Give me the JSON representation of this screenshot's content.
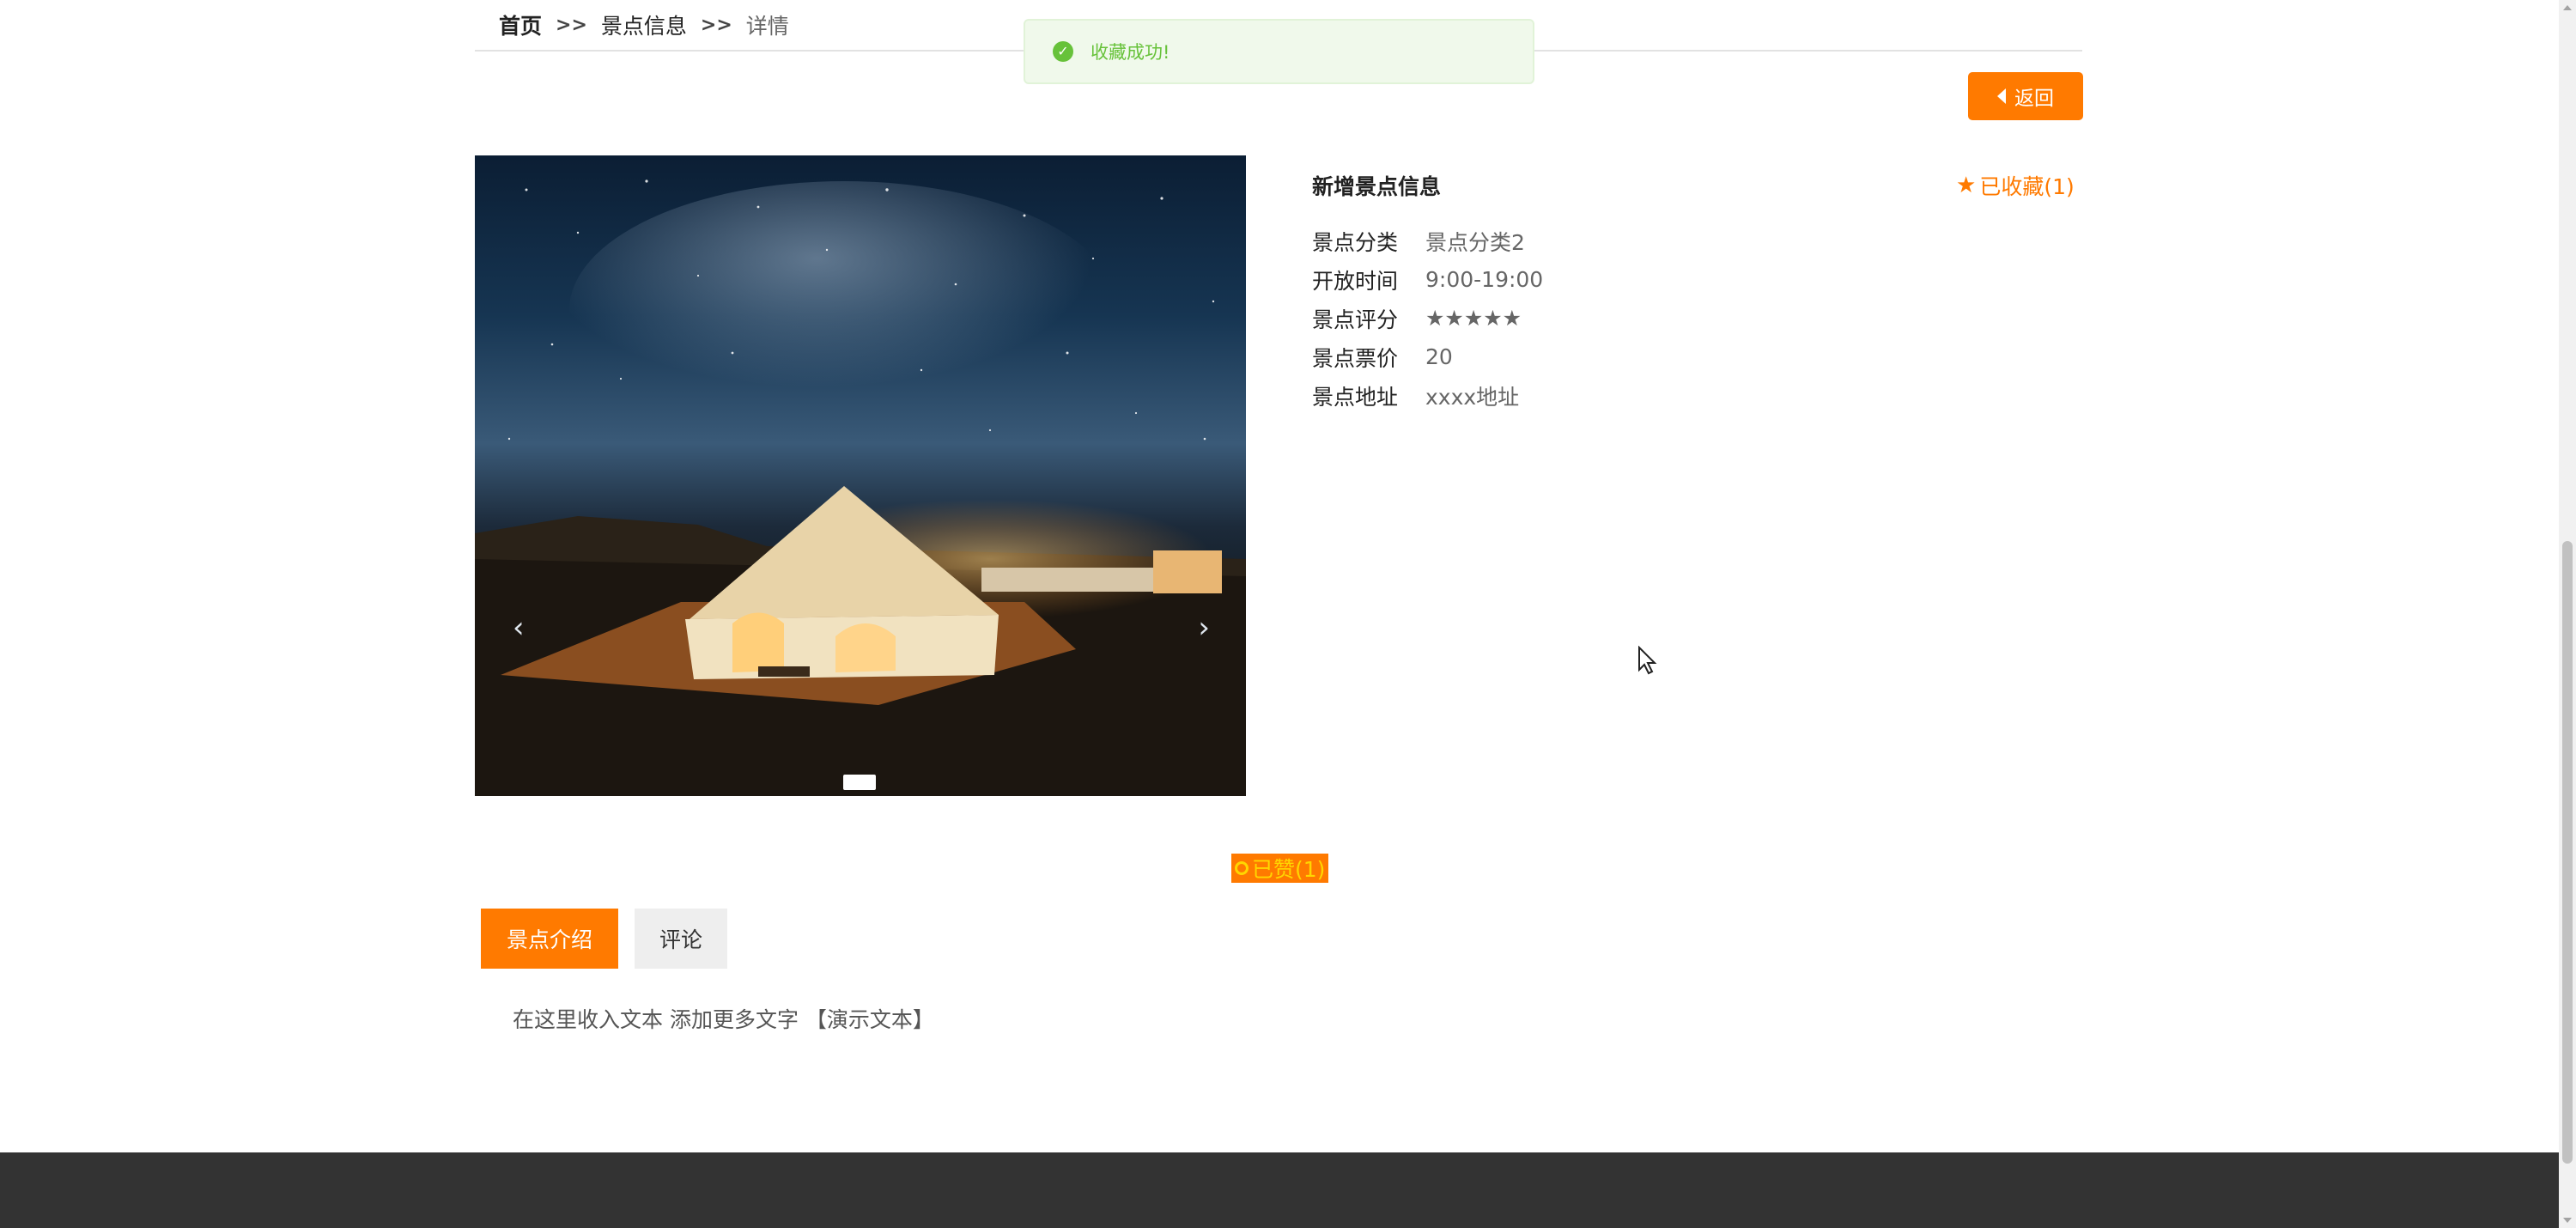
{
  "breadcrumb": {
    "home": "首页",
    "sep1": ">>",
    "scenic": "景点信息",
    "sep2": ">>",
    "current": "详情"
  },
  "toast": {
    "message": "收藏成功!"
  },
  "back_button": {
    "label": "返回"
  },
  "carousel": {
    "prev": "‹",
    "next": "›"
  },
  "info": {
    "title": "新增景点信息",
    "favorite": {
      "icon": "star-icon",
      "label": "已收藏(1)"
    },
    "rows": [
      {
        "label": "景点分类",
        "value": "景点分类2"
      },
      {
        "label": "开放时间",
        "value": "9:00-19:00"
      },
      {
        "label": "景点评分",
        "value": "★★★★★"
      },
      {
        "label": "景点票价",
        "value": "20"
      },
      {
        "label": "景点地址",
        "value": "xxxx地址"
      }
    ]
  },
  "like": {
    "label": "已赞(1)"
  },
  "tabs": [
    {
      "label": "景点介绍"
    },
    {
      "label": "评论"
    }
  ],
  "content": {
    "text": "在这里收入文本 添加更多文字 【演示文本】"
  },
  "colors": {
    "accent": "#ff7a00",
    "success": "#67c23a",
    "footer": "#333333"
  }
}
